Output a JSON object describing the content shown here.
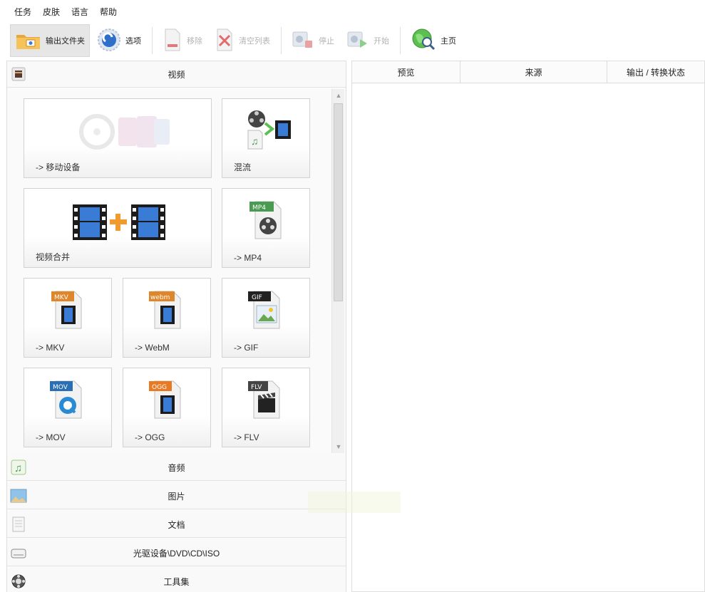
{
  "menu": [
    "任务",
    "皮肤",
    "语言",
    "帮助"
  ],
  "toolbar": {
    "output_folder": "输出文件夹",
    "options": "选项",
    "remove": "移除",
    "clear_list": "清空列表",
    "stop": "停止",
    "start": "开始",
    "home": "主页"
  },
  "left_panel": {
    "video_category": "视频",
    "tiles": {
      "mobile": "-> 移动设备",
      "mux": "混流",
      "merge": "视频合并",
      "mp4": "-> MP4",
      "mkv": "-> MKV",
      "webm": "-> WebM",
      "gif": "-> GIF",
      "mov": "-> MOV",
      "ogg": "-> OGG",
      "flv": "-> FLV"
    },
    "badges": {
      "mp4": "MP4",
      "mkv": "MKV",
      "webm": "webm",
      "gif": "GIF",
      "mov": "MOV",
      "ogg": "OGG",
      "flv": "FLV"
    },
    "categories": {
      "audio": "音频",
      "picture": "图片",
      "document": "文档",
      "disc": "光驱设备\\DVD\\CD\\ISO",
      "tools": "工具集"
    }
  },
  "right_panel": {
    "columns": [
      "预览",
      "来源",
      "输出 / 转换状态"
    ]
  },
  "icons": [
    "folder-icon",
    "options-gear-icon",
    "remove-file-icon",
    "clear-list-icon",
    "stop-icon",
    "start-icon",
    "home-globe-icon",
    "video-film-icon",
    "music-note-icon",
    "picture-icon",
    "document-icon",
    "disc-drive-icon",
    "tools-icon"
  ],
  "colors": {
    "mp4_badge": "#4a9a52",
    "mkv_badge": "#e0862a",
    "webm_badge": "#e0862a",
    "gif_badge": "#222222",
    "mov_badge": "#2a6fb3",
    "ogg_badge": "#e87a24",
    "flv_badge": "#444444",
    "merge_plus": "#f29a2e",
    "film_blue": "#3a7bd5"
  }
}
